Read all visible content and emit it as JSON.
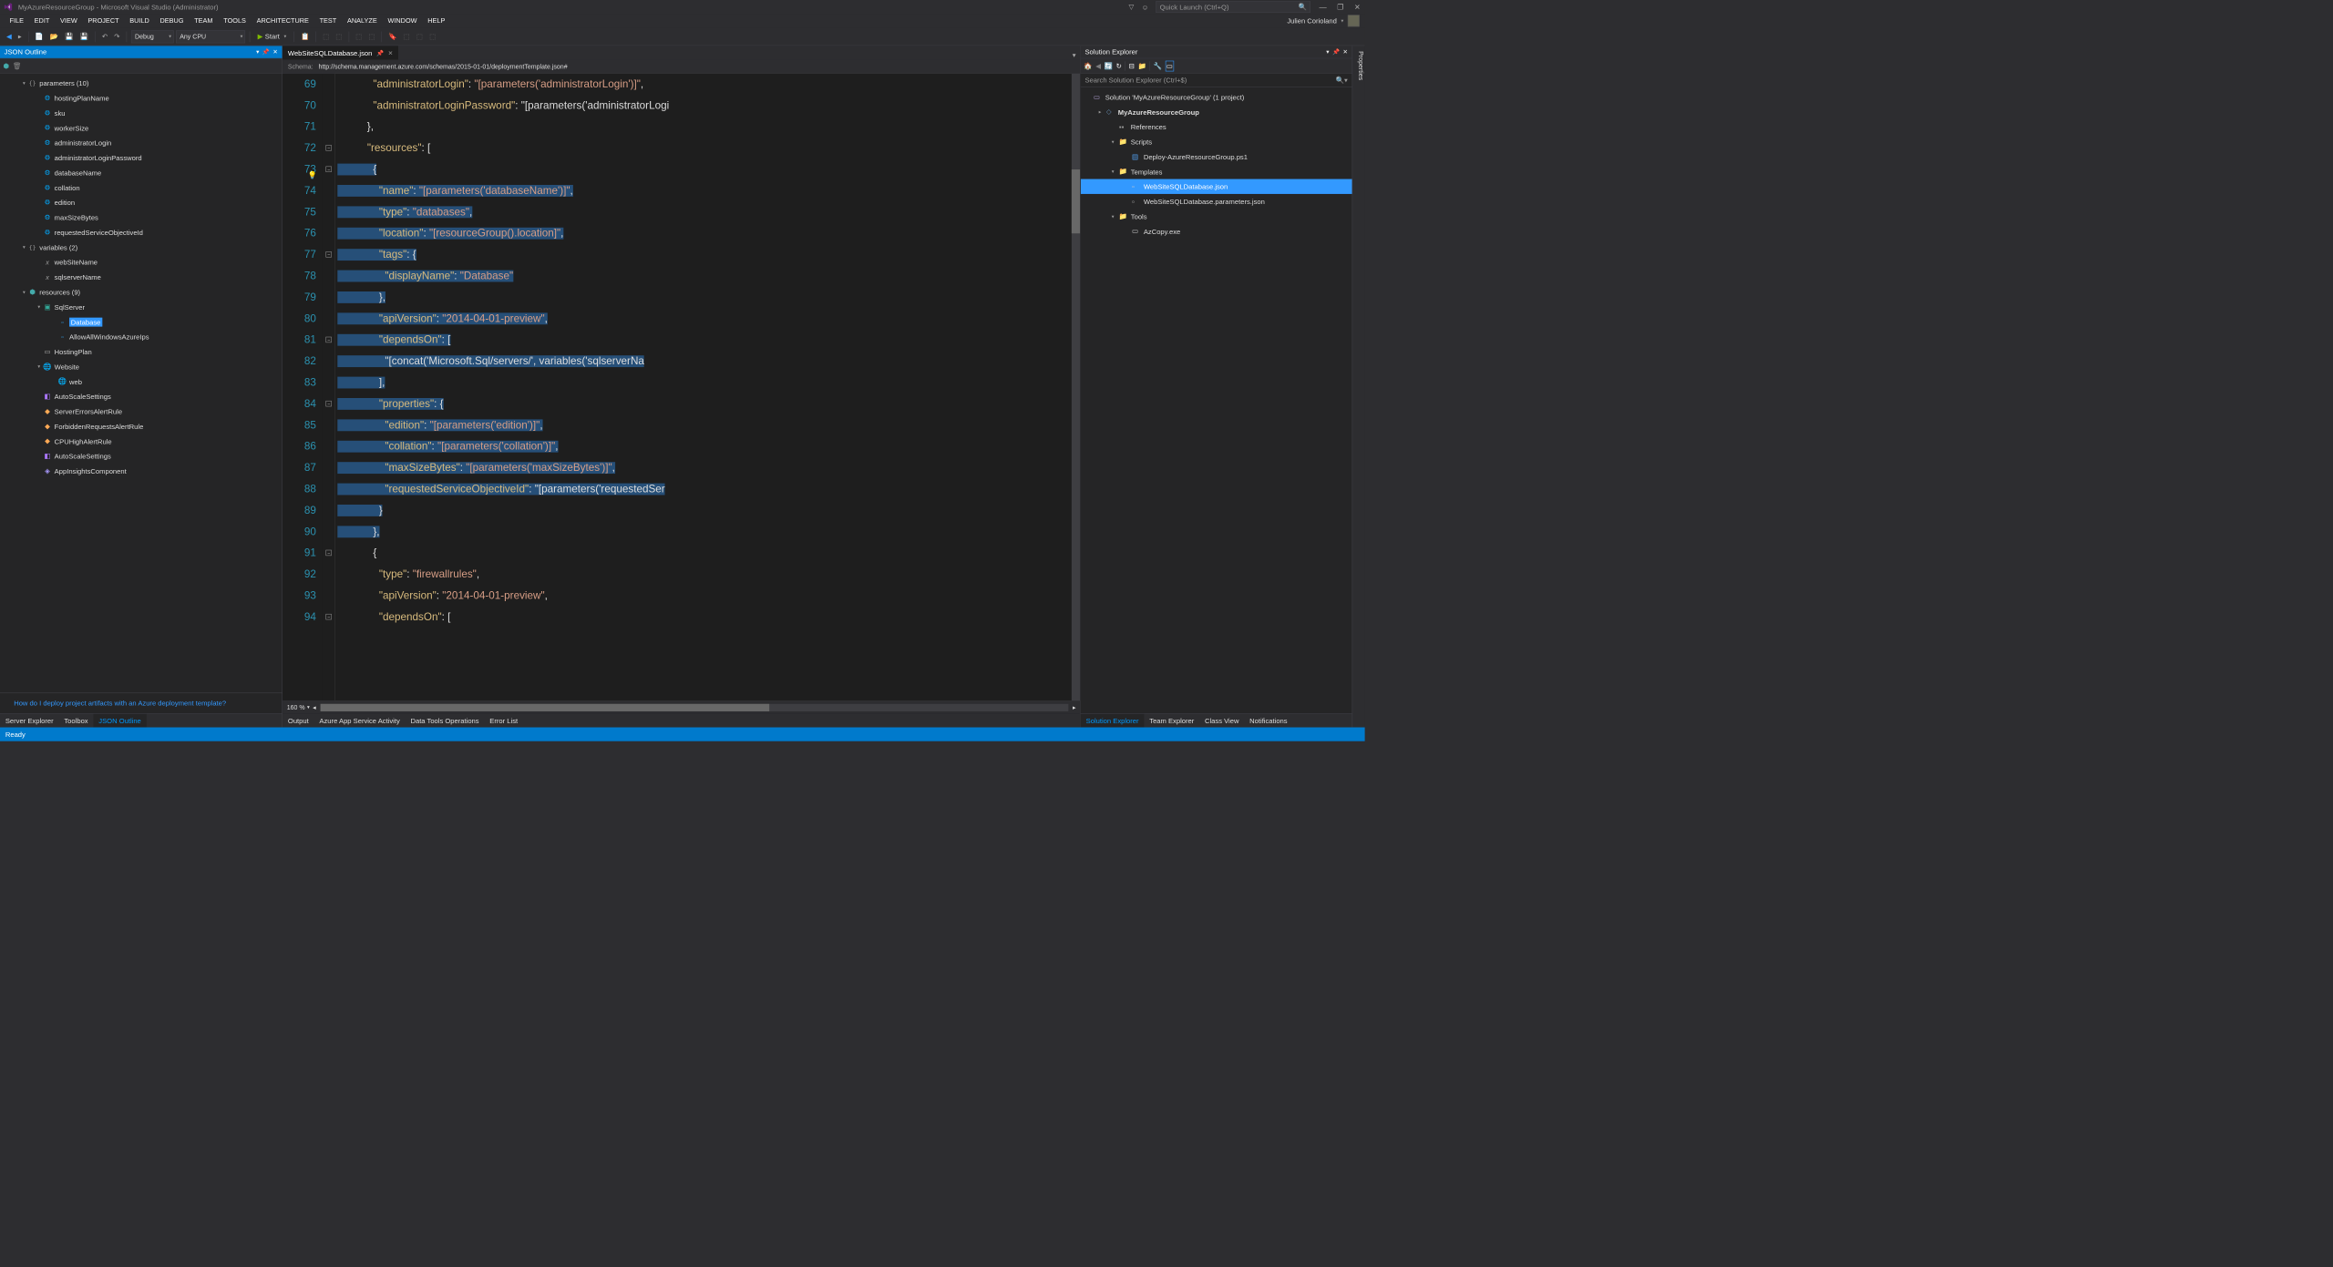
{
  "titleBar": {
    "title": "MyAzureResourceGroup - Microsoft Visual Studio (Administrator)",
    "quickLaunchPlaceholder": "Quick Launch (Ctrl+Q)"
  },
  "menuBar": {
    "items": [
      "FILE",
      "EDIT",
      "VIEW",
      "PROJECT",
      "BUILD",
      "DEBUG",
      "TEAM",
      "TOOLS",
      "ARCHITECTURE",
      "TEST",
      "ANALYZE",
      "WINDOW",
      "HELP"
    ],
    "userName": "Julien Corioland"
  },
  "toolbar": {
    "config": "Debug",
    "platform": "Any CPU",
    "start": "Start"
  },
  "jsonOutline": {
    "title": "JSON Outline",
    "hint": "How do I deploy project artifacts with an Azure deployment template?",
    "tree": [
      {
        "lvl": 0,
        "caret": "▾",
        "icon": "curly",
        "label": "parameters (10)"
      },
      {
        "lvl": 1,
        "caret": "",
        "icon": "gear",
        "label": "hostingPlanName"
      },
      {
        "lvl": 1,
        "caret": "",
        "icon": "gear",
        "label": "sku"
      },
      {
        "lvl": 1,
        "caret": "",
        "icon": "gear",
        "label": "workerSize"
      },
      {
        "lvl": 1,
        "caret": "",
        "icon": "gear",
        "label": "administratorLogin"
      },
      {
        "lvl": 1,
        "caret": "",
        "icon": "gear",
        "label": "administratorLoginPassword"
      },
      {
        "lvl": 1,
        "caret": "",
        "icon": "gear",
        "label": "databaseName"
      },
      {
        "lvl": 1,
        "caret": "",
        "icon": "gear",
        "label": "collation"
      },
      {
        "lvl": 1,
        "caret": "",
        "icon": "gear",
        "label": "edition"
      },
      {
        "lvl": 1,
        "caret": "",
        "icon": "gear",
        "label": "maxSizeBytes"
      },
      {
        "lvl": 1,
        "caret": "",
        "icon": "gear",
        "label": "requestedServiceObjectiveId"
      },
      {
        "lvl": 0,
        "caret": "▾",
        "icon": "curly",
        "label": "variables (2)"
      },
      {
        "lvl": 1,
        "caret": "",
        "icon": "x",
        "label": "webSiteName"
      },
      {
        "lvl": 1,
        "caret": "",
        "icon": "x",
        "label": "sqlserverName"
      },
      {
        "lvl": 0,
        "caret": "▾",
        "icon": "cube",
        "label": "resources (9)"
      },
      {
        "lvl": 1,
        "caret": "▾",
        "icon": "cube2",
        "label": "SqlServer"
      },
      {
        "lvl": 2,
        "caret": "",
        "icon": "cube3",
        "label": "Database",
        "selected": true
      },
      {
        "lvl": 2,
        "caret": "",
        "icon": "cube3",
        "label": "AllowAllWindowsAzureIps"
      },
      {
        "lvl": 1,
        "caret": "",
        "icon": "plan",
        "label": "HostingPlan"
      },
      {
        "lvl": 1,
        "caret": "▾",
        "icon": "globe",
        "label": "Website"
      },
      {
        "lvl": 2,
        "caret": "",
        "icon": "globe",
        "label": "web"
      },
      {
        "lvl": 1,
        "caret": "",
        "icon": "scale",
        "label": "AutoScaleSettings"
      },
      {
        "lvl": 1,
        "caret": "",
        "icon": "rule",
        "label": "ServerErrorsAlertRule"
      },
      {
        "lvl": 1,
        "caret": "",
        "icon": "rule",
        "label": "ForbiddenRequestsAlertRule"
      },
      {
        "lvl": 1,
        "caret": "",
        "icon": "rule",
        "label": "CPUHighAlertRule"
      },
      {
        "lvl": 1,
        "caret": "",
        "icon": "scale",
        "label": "AutoScaleSettings"
      },
      {
        "lvl": 1,
        "caret": "",
        "icon": "app",
        "label": "AppInsightsComponent"
      }
    ]
  },
  "editor": {
    "tabName": "WebSiteSQLDatabase.json",
    "schemaLabel": "Schema:",
    "schemaUrl": "http://schema.management.azure.com/schemas/2015-01-01/deploymentTemplate.json#",
    "zoom": "160 %",
    "lines": [
      {
        "n": 69,
        "text": "            \"administratorLogin\": \"[parameters('administratorLogin')]\","
      },
      {
        "n": 70,
        "text": "            \"administratorLoginPassword\": \"[parameters('administratorLogi"
      },
      {
        "n": 71,
        "text": "          },"
      },
      {
        "n": 72,
        "text": "          \"resources\": ["
      },
      {
        "n": 73,
        "text": "            {",
        "hl": true
      },
      {
        "n": 74,
        "text": "              \"name\": \"[parameters('databaseName')]\",",
        "hl": true
      },
      {
        "n": 75,
        "text": "              \"type\": \"databases\",",
        "hl": true
      },
      {
        "n": 76,
        "text": "              \"location\": \"[resourceGroup().location]\",",
        "hl": true
      },
      {
        "n": 77,
        "text": "              \"tags\": {",
        "hl": true
      },
      {
        "n": 78,
        "text": "                \"displayName\": \"Database\"",
        "hl": true
      },
      {
        "n": 79,
        "text": "              },",
        "hl": true
      },
      {
        "n": 80,
        "text": "              \"apiVersion\": \"2014-04-01-preview\",",
        "hl": true
      },
      {
        "n": 81,
        "text": "              \"dependsOn\": [",
        "hl": true
      },
      {
        "n": 82,
        "text": "                \"[concat('Microsoft.Sql/servers/', variables('sqlserverNa",
        "hl": true
      },
      {
        "n": 83,
        "text": "              ],",
        "hl": true
      },
      {
        "n": 84,
        "text": "              \"properties\": {",
        "hl": true
      },
      {
        "n": 85,
        "text": "                \"edition\": \"[parameters('edition')]\",",
        "hl": true
      },
      {
        "n": 86,
        "text": "                \"collation\": \"[parameters('collation')]\",",
        "hl": true
      },
      {
        "n": 87,
        "text": "                \"maxSizeBytes\": \"[parameters('maxSizeBytes')]\",",
        "hl": true
      },
      {
        "n": 88,
        "text": "                \"requestedServiceObjectiveId\": \"[parameters('requestedSer",
        "hl": true
      },
      {
        "n": 89,
        "text": "              }",
        "hl": true
      },
      {
        "n": 90,
        "text": "            },",
        "hl": true
      },
      {
        "n": 91,
        "text": "            {"
      },
      {
        "n": 92,
        "text": "              \"type\": \"firewallrules\","
      },
      {
        "n": 93,
        "text": "              \"apiVersion\": \"2014-04-01-preview\","
      },
      {
        "n": 94,
        "text": "              \"dependsOn\": ["
      }
    ]
  },
  "solutionExplorer": {
    "title": "Solution Explorer",
    "searchPlaceholder": "Search Solution Explorer (Ctrl+$)",
    "tree": [
      {
        "lvl": 0,
        "caret": "",
        "icon": "sol",
        "label": "Solution 'MyAzureResourceGroup' (1 project)"
      },
      {
        "lvl": 1,
        "caret": "▸",
        "icon": "proj",
        "label": "MyAzureResourceGroup",
        "bold": true
      },
      {
        "lvl": 2,
        "caret": "",
        "icon": "ref",
        "label": "References"
      },
      {
        "lvl": 2,
        "caret": "▾",
        "icon": "folder",
        "label": "Scripts"
      },
      {
        "lvl": 3,
        "caret": "",
        "icon": "ps1",
        "label": "Deploy-AzureResourceGroup.ps1"
      },
      {
        "lvl": 2,
        "caret": "▾",
        "icon": "folder",
        "label": "Templates"
      },
      {
        "lvl": 3,
        "caret": "",
        "icon": "json",
        "label": "WebSiteSQLDatabase.json",
        "selected": true
      },
      {
        "lvl": 3,
        "caret": "",
        "icon": "json",
        "label": "WebSiteSQLDatabase.parameters.json"
      },
      {
        "lvl": 2,
        "caret": "▾",
        "icon": "folder",
        "label": "Tools"
      },
      {
        "lvl": 3,
        "caret": "",
        "icon": "exe",
        "label": "AzCopy.exe"
      }
    ]
  },
  "bottomLeftTabs": [
    "Server Explorer",
    "Toolbox",
    "JSON Outline"
  ],
  "bottomLeftActive": "JSON Outline",
  "bottomRightTabs": [
    "Solution Explorer",
    "Team Explorer",
    "Class View",
    "Notifications"
  ],
  "bottomRightActive": "Solution Explorer",
  "bottomRow2": [
    "Output",
    "Azure App Service Activity",
    "Data Tools Operations",
    "Error List"
  ],
  "rightEdge": "Properties",
  "statusBar": "Ready"
}
